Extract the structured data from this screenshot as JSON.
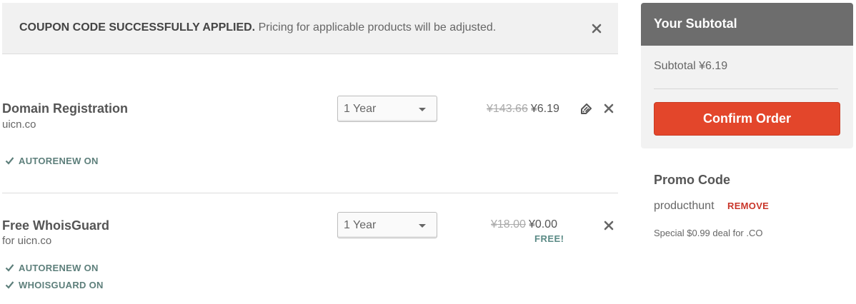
{
  "banner": {
    "strong_text": "COUPON CODE SUCCESSFULLY APPLIED.",
    "text": "Pricing for applicable products will be adjusted."
  },
  "products": [
    {
      "title": "Domain Registration",
      "subtitle": "uicn.co",
      "term": "1 Year",
      "old_price": "¥143.66",
      "price": "¥6.19",
      "statuses": [
        "AUTORENEW ON"
      ]
    },
    {
      "title": "Free WhoisGuard",
      "subtitle": "for uicn.co",
      "term": "1 Year",
      "old_price": "¥18.00",
      "price": "¥0.00",
      "free_label": "FREE!",
      "statuses": [
        "AUTORENEW ON",
        "WHOISGUARD ON"
      ]
    }
  ],
  "sidebar": {
    "heading": "Your Subtotal",
    "subtotal_text": "Subtotal ¥6.19",
    "confirm_label": "Confirm Order",
    "promo_title": "Promo Code",
    "promo_code": "producthunt",
    "remove_label": "REMOVE",
    "promo_note": "Special $0.99 deal for .CO"
  },
  "icons": {
    "close": "close-icon",
    "tag": "tag-icon",
    "check": "check-icon",
    "caret": "chevron-down-icon"
  },
  "colors": {
    "accent": "#e3462b",
    "status_teal": "#5d7f7b",
    "remove_red": "#c9362a",
    "header_gray": "#6d6d6d"
  }
}
